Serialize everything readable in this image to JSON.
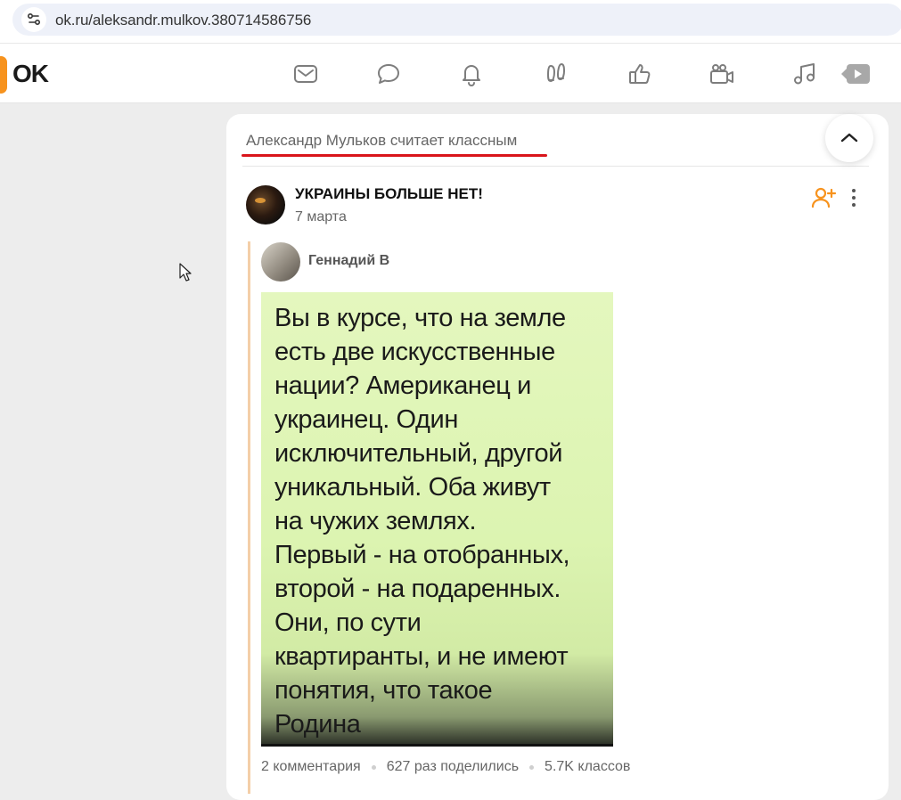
{
  "browser": {
    "url": "ok.ru/aleksandr.mulkov.380714586756",
    "site_settings_icon": "tune-icon"
  },
  "header": {
    "logo_text": "OK",
    "logo_color": "#f7931e",
    "nav_icons": [
      "mail-icon",
      "chat-icon",
      "bell-icon",
      "guests-icon",
      "like-icon",
      "video-camera-icon",
      "music-icon",
      "video-play-icon"
    ]
  },
  "feed": {
    "reason_text": "Александр Мульков считает классным",
    "reason_underline_color": "#d9151b",
    "group": {
      "title": "УКРАИНЫ БОЛЬШЕ НЕТ!",
      "date": "7 марта"
    },
    "repost": {
      "author": "Геннадий В",
      "image_text": "Вы в курсе, что на земле\nесть две искусственные\nнации? Американец и\nукраинец. Один\nисключительный, другой\nуникальный. Оба живут\nна чужих землях.\nПервый - на отобранных,\nвторой - на подаренных.\nОни, по сути\nквартиранты, и не имеют\nпонятия, что такое\nРодина"
    },
    "stats": {
      "comments": "2 комментария",
      "shares": "627 раз поделились",
      "likes": "5.7K классов"
    }
  }
}
